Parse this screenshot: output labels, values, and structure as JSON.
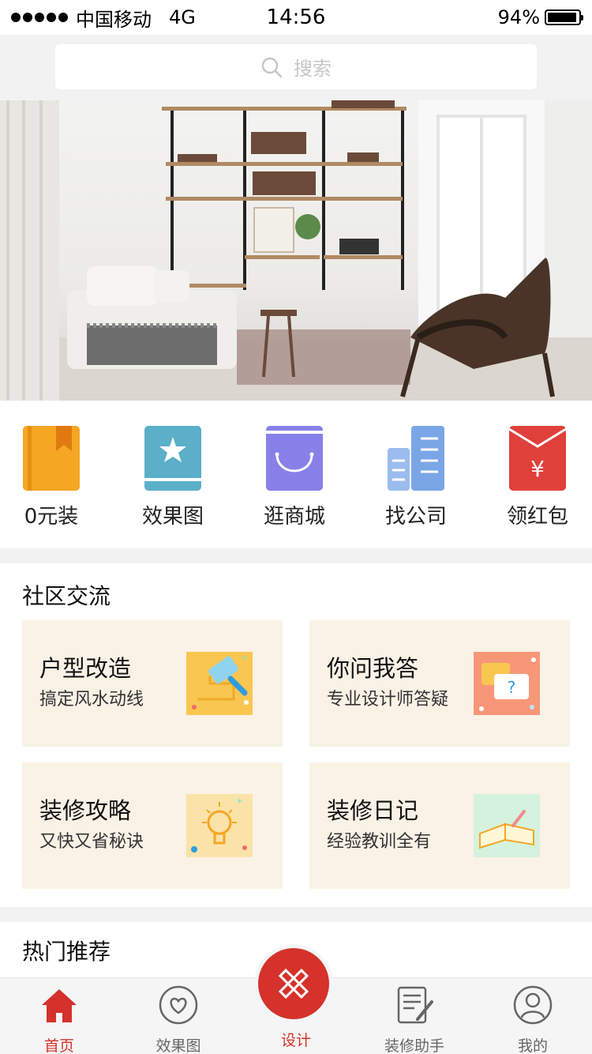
{
  "status_bar": {
    "carrier": "中国移动",
    "network": "4G",
    "time": "14:56",
    "battery": "94%",
    "battery_level": 0.94
  },
  "search": {
    "placeholder": "搜索",
    "icon": "search-icon"
  },
  "quick_nav": [
    {
      "label": "0元装",
      "icon": "orange-book-icon",
      "color": "#f5a623"
    },
    {
      "label": "效果图",
      "icon": "star-book-icon",
      "color": "#5bafc9"
    },
    {
      "label": "逛商城",
      "icon": "shopping-bag-icon",
      "color": "#8780e8"
    },
    {
      "label": "找公司",
      "icon": "buildings-icon",
      "color": "#7aa6e6"
    },
    {
      "label": "领红包",
      "icon": "red-envelope-icon",
      "color": "#e0403a"
    }
  ],
  "community": {
    "title": "社区交流",
    "cards": [
      {
        "title": "户型改造",
        "subtitle": "搞定风水动线",
        "icon": "hammer-icon"
      },
      {
        "title": "你问我答",
        "subtitle": "专业设计师答疑",
        "icon": "chat-bubble-icon"
      },
      {
        "title": "装修攻略",
        "subtitle": "又快又省秘诀",
        "icon": "lightbulb-icon"
      },
      {
        "title": "装修日记",
        "subtitle": "经验教训全有",
        "icon": "open-book-icon"
      }
    ]
  },
  "hot": {
    "title": "热门推荐"
  },
  "tabs": [
    {
      "label": "首页",
      "icon": "home-icon",
      "active": true
    },
    {
      "label": "效果图",
      "icon": "heart-icon",
      "active": false
    },
    {
      "label": "设计",
      "icon": "ruler-pencil-icon",
      "active": false
    },
    {
      "label": "装修助手",
      "icon": "notepad-icon",
      "active": false
    },
    {
      "label": "我的",
      "icon": "user-icon",
      "active": false
    }
  ],
  "colors": {
    "accent": "#d4322a",
    "card_bg": "#fbf2e6"
  }
}
